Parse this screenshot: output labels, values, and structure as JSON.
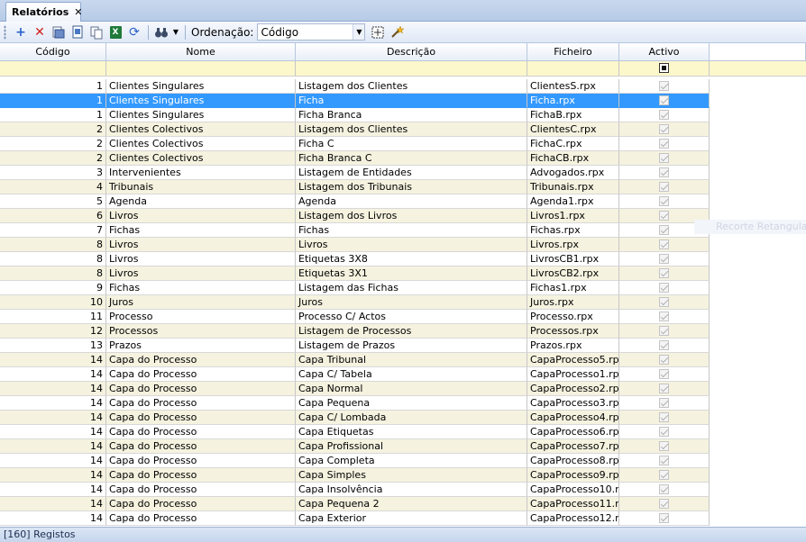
{
  "tab": {
    "label": "Relatórios",
    "close": "✕"
  },
  "toolbar": {
    "order_label": "Ordenação:",
    "order_value": "Código",
    "buttons": [
      "add-icon",
      "delete-icon",
      "edit-icon",
      "preview-icon",
      "copy-icon",
      "excel-icon",
      "refresh-icon",
      "find-icon",
      "dropdown-arrow-icon",
      "grid-select-icon",
      "wand-icon"
    ]
  },
  "colors": {
    "selected_row": "#3399ff",
    "alt_row": "#f5f2df",
    "filter_row": "#fdf7cc"
  },
  "columns": {
    "codigo": "Código",
    "nome": "Nome",
    "descricao": "Descrição",
    "ficheiro": "Ficheiro",
    "activo": "Activo"
  },
  "rows": [
    {
      "codigo": "1",
      "nome": "Clientes Singulares",
      "descricao": "Listagem dos Clientes",
      "ficheiro": "ClientesS.rpx"
    },
    {
      "codigo": "1",
      "nome": "Clientes Singulares",
      "descricao": "Ficha",
      "ficheiro": "Ficha.rpx"
    },
    {
      "codigo": "1",
      "nome": "Clientes Singulares",
      "descricao": "Ficha Branca",
      "ficheiro": "FichaB.rpx"
    },
    {
      "codigo": "2",
      "nome": "Clientes Colectivos",
      "descricao": "Listagem dos Clientes",
      "ficheiro": "ClientesC.rpx"
    },
    {
      "codigo": "2",
      "nome": "Clientes Colectivos",
      "descricao": "Ficha C",
      "ficheiro": "FichaC.rpx"
    },
    {
      "codigo": "2",
      "nome": "Clientes Colectivos",
      "descricao": "Ficha Branca C",
      "ficheiro": "FichaCB.rpx"
    },
    {
      "codigo": "3",
      "nome": "Intervenientes",
      "descricao": "Listagem de Entidades",
      "ficheiro": "Advogados.rpx"
    },
    {
      "codigo": "4",
      "nome": "Tribunais",
      "descricao": "Listagem dos Tribunais",
      "ficheiro": "Tribunais.rpx"
    },
    {
      "codigo": "5",
      "nome": "Agenda",
      "descricao": "Agenda",
      "ficheiro": "Agenda1.rpx"
    },
    {
      "codigo": "6",
      "nome": "Livros",
      "descricao": "Listagem dos Livros",
      "ficheiro": "Livros1.rpx"
    },
    {
      "codigo": "7",
      "nome": "Fichas",
      "descricao": "Fichas",
      "ficheiro": "Fichas.rpx"
    },
    {
      "codigo": "8",
      "nome": "Livros",
      "descricao": "Livros",
      "ficheiro": "Livros.rpx"
    },
    {
      "codigo": "8",
      "nome": "Livros",
      "descricao": "Etiquetas 3X8",
      "ficheiro": "LivrosCB1.rpx"
    },
    {
      "codigo": "8",
      "nome": "Livros",
      "descricao": "Etiquetas 3X1",
      "ficheiro": "LivrosCB2.rpx"
    },
    {
      "codigo": "9",
      "nome": "Fichas",
      "descricao": "Listagem das Fichas",
      "ficheiro": "Fichas1.rpx"
    },
    {
      "codigo": "10",
      "nome": "Juros",
      "descricao": "Juros",
      "ficheiro": "Juros.rpx"
    },
    {
      "codigo": "11",
      "nome": "Processo",
      "descricao": "Processo C/ Actos",
      "ficheiro": "Processo.rpx"
    },
    {
      "codigo": "12",
      "nome": "Processos",
      "descricao": "Listagem de Processos",
      "ficheiro": "Processos.rpx"
    },
    {
      "codigo": "13",
      "nome": "Prazos",
      "descricao": "Listagem de Prazos",
      "ficheiro": "Prazos.rpx"
    },
    {
      "codigo": "14",
      "nome": "Capa do Processo",
      "descricao": "Capa Tribunal",
      "ficheiro": "CapaProcesso5.rp"
    },
    {
      "codigo": "14",
      "nome": "Capa do Processo",
      "descricao": "Capa C/ Tabela",
      "ficheiro": "CapaProcesso1.rp"
    },
    {
      "codigo": "14",
      "nome": "Capa do Processo",
      "descricao": "Capa Normal",
      "ficheiro": "CapaProcesso2.rp"
    },
    {
      "codigo": "14",
      "nome": "Capa do Processo",
      "descricao": "Capa Pequena",
      "ficheiro": "CapaProcesso3.rp"
    },
    {
      "codigo": "14",
      "nome": "Capa do Processo",
      "descricao": "Capa C/ Lombada",
      "ficheiro": "CapaProcesso4.rp"
    },
    {
      "codigo": "14",
      "nome": "Capa do Processo",
      "descricao": "Capa Etiquetas",
      "ficheiro": "CapaProcesso6.rp"
    },
    {
      "codigo": "14",
      "nome": "Capa do Processo",
      "descricao": "Capa Profissional",
      "ficheiro": "CapaProcesso7.rp"
    },
    {
      "codigo": "14",
      "nome": "Capa do Processo",
      "descricao": "Capa Completa",
      "ficheiro": "CapaProcesso8.rp"
    },
    {
      "codigo": "14",
      "nome": "Capa do Processo",
      "descricao": "Capa Simples",
      "ficheiro": "CapaProcesso9.rp"
    },
    {
      "codigo": "14",
      "nome": "Capa do Processo",
      "descricao": "Capa Insolvência",
      "ficheiro": "CapaProcesso10.r"
    },
    {
      "codigo": "14",
      "nome": "Capa do Processo",
      "descricao": "Capa Pequena 2",
      "ficheiro": "CapaProcesso11.r"
    },
    {
      "codigo": "14",
      "nome": "Capa do Processo",
      "descricao": "Capa Exterior",
      "ficheiro": "CapaProcesso12.r"
    }
  ],
  "selected_row": 1,
  "ghost_text": "Recorte Retangular",
  "status": "[160] Registos"
}
